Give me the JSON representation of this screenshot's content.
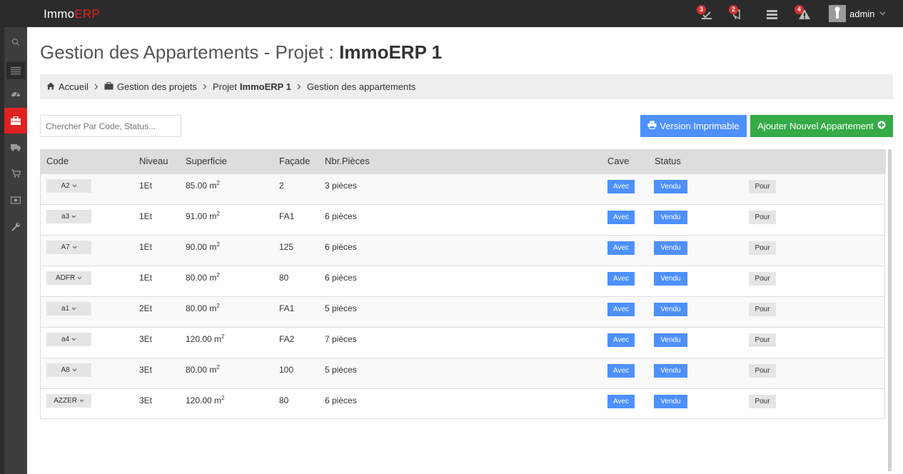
{
  "app": {
    "logo_main": "Immo",
    "logo_accent": "ERP"
  },
  "topbar": {
    "notifications": [
      {
        "icon": "task-check-icon",
        "count": "3"
      },
      {
        "icon": "megaphone-icon",
        "count": "2"
      },
      {
        "icon": "server-icon",
        "count": ""
      },
      {
        "icon": "warning-icon",
        "count": "4"
      }
    ],
    "user_name": "admin"
  },
  "sidebar": {
    "items": [
      {
        "name": "search-icon"
      },
      {
        "name": "list-icon"
      },
      {
        "name": "dashboard-icon"
      },
      {
        "name": "briefcase-icon",
        "active": true
      },
      {
        "name": "truck-icon"
      },
      {
        "name": "cart-icon"
      },
      {
        "name": "money-icon"
      },
      {
        "name": "wrench-icon"
      }
    ]
  },
  "page": {
    "title_prefix": "Gestion des Appartements - Projet : ",
    "title_strong": "ImmoERP 1"
  },
  "breadcrumb": {
    "home": "Accueil",
    "projects": "Gestion des projets",
    "project_prefix": "Projet",
    "project_name": "ImmoERP 1",
    "current": "Gestion des appartements"
  },
  "search": {
    "placeholder": "Chercher Par Code, Status..."
  },
  "actions": {
    "print_label": "Version Imprimable",
    "add_label": "Ajouter Nouvel Appartement"
  },
  "table": {
    "headers": {
      "code": "Code",
      "niveau": "Niveau",
      "superficie": "Superficie",
      "facade": "Façade",
      "pieces": "Nbr.Pièces",
      "cave": "Cave",
      "status": "Status"
    },
    "rows": [
      {
        "code": "A2",
        "niveau": "1Et",
        "superficie": "85.00 m",
        "facade": "2",
        "pieces": "3 pièces",
        "cave": "Avec",
        "status": "Vendu",
        "pour": "Pour"
      },
      {
        "code": "a3",
        "niveau": "1Et",
        "superficie": "91.00 m",
        "facade": "FA1",
        "pieces": "6 pièces",
        "cave": "Avec",
        "status": "Vendu",
        "pour": "Pour"
      },
      {
        "code": "A7",
        "niveau": "1Et",
        "superficie": "90.00 m",
        "facade": "125",
        "pieces": "6 pièces",
        "cave": "Avec",
        "status": "Vendu",
        "pour": "Pour"
      },
      {
        "code": "ADFR",
        "niveau": "1Et",
        "superficie": "80.00 m",
        "facade": "80",
        "pieces": "6 pièces",
        "cave": "Avec",
        "status": "Vendu",
        "pour": "Pour"
      },
      {
        "code": "a1",
        "niveau": "2Et",
        "superficie": "80.00 m",
        "facade": "FA1",
        "pieces": "5 pièces",
        "cave": "Avec",
        "status": "Vendu",
        "pour": "Pour"
      },
      {
        "code": "a4",
        "niveau": "3Et",
        "superficie": "120.00 m",
        "facade": "FA2",
        "pieces": "7 pièces",
        "cave": "Avec",
        "status": "Vendu",
        "pour": "Pour"
      },
      {
        "code": "A8",
        "niveau": "3Et",
        "superficie": "80.00 m",
        "facade": "100",
        "pieces": "5 pièces",
        "cave": "Avec",
        "status": "Vendu",
        "pour": "Pour"
      },
      {
        "code": "AZZER",
        "niveau": "3Et",
        "superficie": "120.00 m",
        "facade": "80",
        "pieces": "6 pièces",
        "cave": "Avec",
        "status": "Vendu",
        "pour": "Pour"
      }
    ],
    "unit_exponent": "2"
  },
  "colors": {
    "accent": "#e02222",
    "primary": "#4d90fe",
    "success": "#35aa47",
    "topbar": "#2b2b2b",
    "sidebar": "#3d3d3d"
  }
}
